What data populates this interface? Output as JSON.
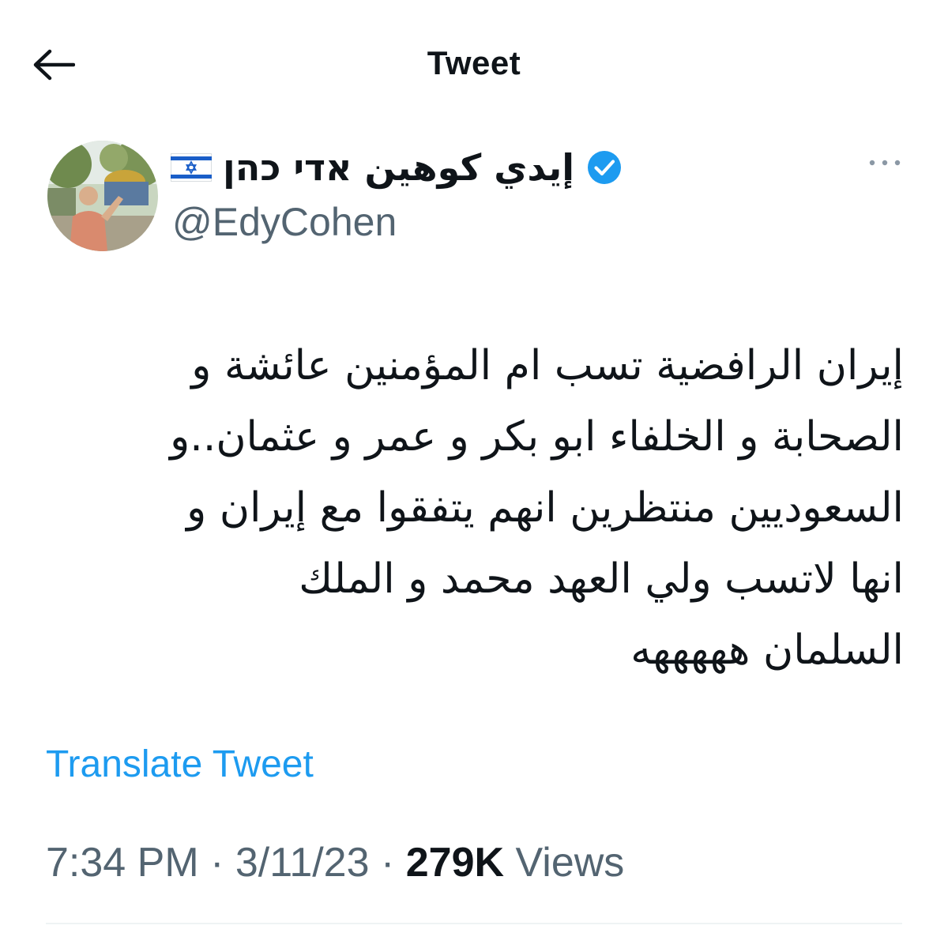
{
  "header": {
    "title": "Tweet",
    "back_icon": "arrow-left-icon"
  },
  "author": {
    "display_name": "إيدي كوهين אדי כהן",
    "handle": "@EdyCohen",
    "verified": true,
    "flag_icon": "israel-flag-icon"
  },
  "tweet": {
    "text": "إيران الرافضية تسب ام المؤمنين عائشة و\nالصحابة و الخلفاء ابو بكر و عمر و عثمان..و\nالسعوديين منتظرين انهم يتفقوا مع إيران و\nانها لاتسب ولي العهد محمد و الملك\nالسلمان هههههه",
    "translate_label": "Translate Tweet",
    "time": "7:34 PM",
    "date": "3/11/23",
    "separator": "·",
    "views_count": "279K",
    "views_label": "Views"
  },
  "colors": {
    "accent": "#1d9bf0",
    "text_primary": "#0f1419",
    "text_secondary": "#536471",
    "divider": "#eff3f4"
  }
}
